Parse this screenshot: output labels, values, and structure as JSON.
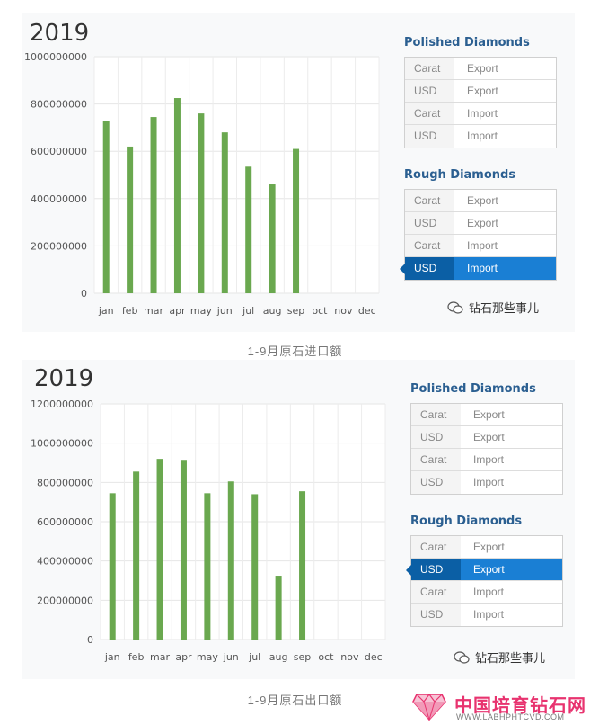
{
  "charts": [
    {
      "year": "2019",
      "caption": "1-9月原石进口额",
      "side": {
        "polished_title": "Polished Diamonds",
        "polished_rows": [
          {
            "unit": "Carat",
            "flow": "Export",
            "active": false
          },
          {
            "unit": "USD",
            "flow": "Export",
            "active": false
          },
          {
            "unit": "Carat",
            "flow": "Import",
            "active": false
          },
          {
            "unit": "USD",
            "flow": "Import",
            "active": false
          }
        ],
        "rough_title": "Rough Diamonds",
        "rough_rows": [
          {
            "unit": "Carat",
            "flow": "Export",
            "active": false
          },
          {
            "unit": "USD",
            "flow": "Export",
            "active": false
          },
          {
            "unit": "Carat",
            "flow": "Import",
            "active": false
          },
          {
            "unit": "USD",
            "flow": "Import",
            "active": true
          }
        ]
      },
      "wechat": "钻石那些事儿"
    },
    {
      "year": "2019",
      "caption": "1-9月原石出口额",
      "side": {
        "polished_title": "Polished Diamonds",
        "polished_rows": [
          {
            "unit": "Carat",
            "flow": "Export",
            "active": false
          },
          {
            "unit": "USD",
            "flow": "Export",
            "active": false
          },
          {
            "unit": "Carat",
            "flow": "Import",
            "active": false
          },
          {
            "unit": "USD",
            "flow": "Import",
            "active": false
          }
        ],
        "rough_title": "Rough Diamonds",
        "rough_rows": [
          {
            "unit": "Carat",
            "flow": "Export",
            "active": false
          },
          {
            "unit": "USD",
            "flow": "Export",
            "active": true
          },
          {
            "unit": "Carat",
            "flow": "Import",
            "active": false
          },
          {
            "unit": "USD",
            "flow": "Import",
            "active": false
          }
        ]
      },
      "wechat": "钻石那些事儿"
    }
  ],
  "logo": {
    "name": "中国培育钻石网",
    "url": "WWW.LABHPHTCVD.COM"
  },
  "chart_data": [
    {
      "type": "bar",
      "title": "2019",
      "categories": [
        "jan",
        "feb",
        "mar",
        "apr",
        "may",
        "jun",
        "jul",
        "aug",
        "sep",
        "oct",
        "nov",
        "dec"
      ],
      "values": [
        727000000,
        620000000,
        745000000,
        825000000,
        760000000,
        680000000,
        535000000,
        460000000,
        610000000,
        null,
        null,
        null
      ],
      "ylim": [
        0,
        1000000000
      ],
      "yticks": [
        "0",
        "200000000",
        "400000000",
        "600000000",
        "800000000",
        "1000000000"
      ],
      "grid": true,
      "bar_color": "#6aa84f"
    },
    {
      "type": "bar",
      "title": "2019",
      "categories": [
        "jan",
        "feb",
        "mar",
        "apr",
        "may",
        "jun",
        "jul",
        "aug",
        "sep",
        "oct",
        "nov",
        "dec"
      ],
      "values": [
        745000000,
        855000000,
        920000000,
        915000000,
        745000000,
        805000000,
        740000000,
        325000000,
        755000000,
        null,
        null,
        null
      ],
      "ylim": [
        0,
        1200000000
      ],
      "yticks": [
        "0",
        "200000000",
        "400000000",
        "600000000",
        "800000000",
        "1000000000",
        "1200000000"
      ],
      "grid": true,
      "bar_color": "#6aa84f"
    }
  ]
}
